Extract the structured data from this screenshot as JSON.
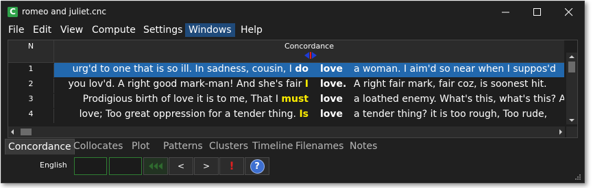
{
  "window": {
    "title": "romeo and juliet.cnc",
    "app_icon_letter": "C"
  },
  "menu": [
    "File",
    "Edit",
    "View",
    "Compute",
    "Settings",
    "Windows",
    "Help"
  ],
  "active_menu": "Windows",
  "concordance": {
    "col_n": "N",
    "col_conc": "Concordance",
    "rows": [
      {
        "n": "1",
        "left": "urg'd to one that is so ill. In sadness, cousin, I ",
        "hit": "do",
        "hit_color": "white",
        "keyword": "love",
        "right": "a woman. I aim'd so near when I suppos'd",
        "selected": true
      },
      {
        "n": "2",
        "left": "you lov'd. A right good mark-man! And she's fair ",
        "hit": "I",
        "hit_color": "yellow",
        "keyword": "love.",
        "right": "A right fair mark, fair coz, is soonest hit.",
        "selected": false
      },
      {
        "n": "3",
        "left": "Prodigious birth of love it is to me, That I ",
        "hit": "must",
        "hit_color": "yellow",
        "keyword": "love",
        "right": "a loathed enemy. What's this, what's this? A",
        "selected": false
      },
      {
        "n": "4",
        "left": "love; Too great oppression for a tender thing. ",
        "hit": "Is",
        "hit_color": "yellow",
        "keyword": "love",
        "right": "a tender thing? it is too rough, Too rude,",
        "selected": false
      }
    ]
  },
  "tabs": [
    "Concordance",
    "Collocates",
    "Plot",
    "Patterns",
    "Clusters",
    "Timeline",
    "Filenames",
    "Notes"
  ],
  "active_tab": "Concordance",
  "toolbar": {
    "language": "English",
    "prev": "<",
    "next": ">",
    "alert": "!",
    "help": "?"
  },
  "colors": {
    "selection": "#2268ad",
    "hit_yellow": "#ffee00",
    "accent_green": "#2f7f33",
    "alert_red": "#e02020",
    "help_blue": "#3d6fd1"
  }
}
